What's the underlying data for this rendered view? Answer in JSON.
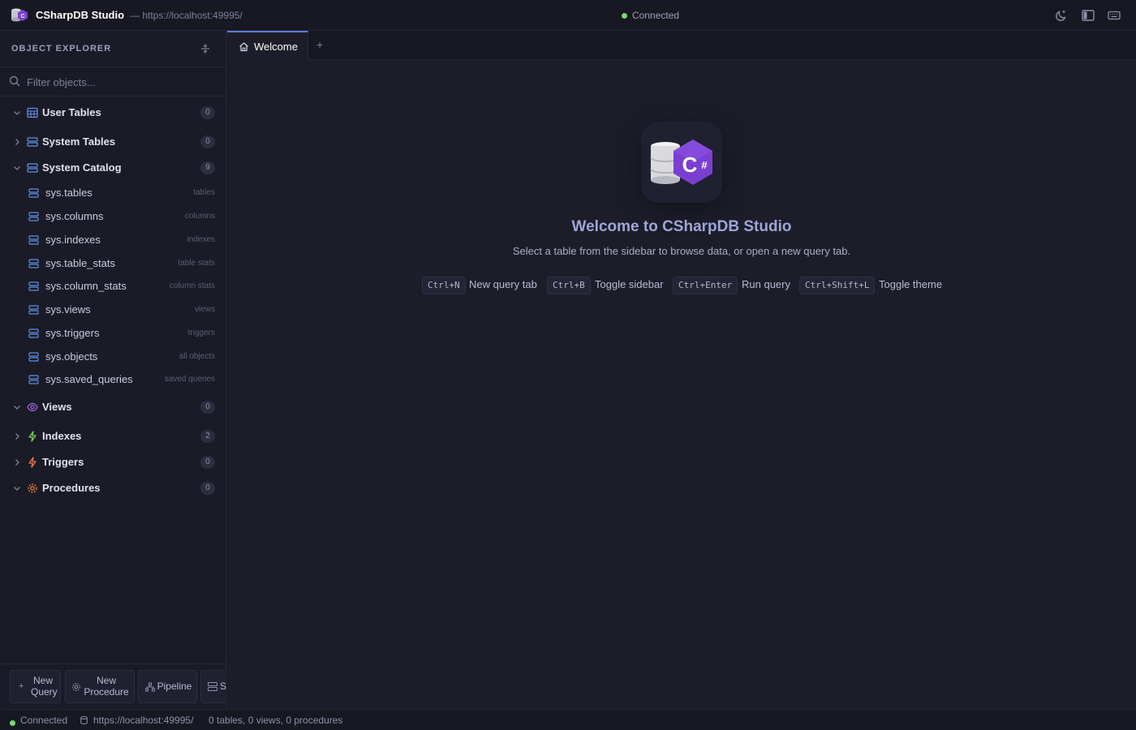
{
  "app": {
    "title": "CSharpDB Studio",
    "url": "— https://localhost:49995/",
    "status": "Connected"
  },
  "icons": {
    "theme": "moon-icon",
    "sidebar": "panel-left-icon",
    "shortcuts": "keyboard-icon"
  },
  "sidebar": {
    "header": "OBJECT EXPLORER",
    "filter_placeholder": "Filter objects...",
    "groups": [
      {
        "label": "User Tables",
        "count": "0",
        "expanded": true
      },
      {
        "label": "System Tables",
        "count": "0",
        "expanded": false
      },
      {
        "label": "System Catalog",
        "count": "9",
        "expanded": true
      },
      {
        "label": "Views",
        "count": "0",
        "expanded": true
      },
      {
        "label": "Indexes",
        "count": "2",
        "expanded": false
      },
      {
        "label": "Triggers",
        "count": "0",
        "expanded": false
      },
      {
        "label": "Procedures",
        "count": "0",
        "expanded": true
      }
    ],
    "catalog_items": [
      {
        "label": "sys.tables",
        "hint": "tables"
      },
      {
        "label": "sys.columns",
        "hint": "columns"
      },
      {
        "label": "sys.indexes",
        "hint": "indexes"
      },
      {
        "label": "sys.table_stats",
        "hint": "table stats"
      },
      {
        "label": "sys.column_stats",
        "hint": "column stats"
      },
      {
        "label": "sys.views",
        "hint": "views"
      },
      {
        "label": "sys.triggers",
        "hint": "triggers"
      },
      {
        "label": "sys.objects",
        "hint": "all objects"
      },
      {
        "label": "sys.saved_queries",
        "hint": "saved queries"
      }
    ],
    "footer": {
      "new_query": [
        "New",
        "Query"
      ],
      "new_procedure": [
        "New",
        "Procedure"
      ],
      "pipeline": "Pipeline",
      "truncated": "St"
    }
  },
  "tabs": [
    {
      "label": "Welcome",
      "active": true
    }
  ],
  "tab_add": "+",
  "welcome": {
    "title": "Welcome to CSharpDB Studio",
    "subtitle": "Select a table from the sidebar to browse data, or open a new query tab.",
    "shortcuts": [
      {
        "keys": "Ctrl+N",
        "label": "New query tab"
      },
      {
        "keys": "Ctrl+B",
        "label": "Toggle sidebar"
      },
      {
        "keys": "Ctrl+Enter",
        "label": "Run query"
      },
      {
        "keys": "Ctrl+Shift+L",
        "label": "Toggle theme"
      }
    ]
  },
  "statusbar": {
    "status": "Connected",
    "url": "https://localhost:49995/",
    "summary": "0 tables, 0 views, 0 procedures"
  },
  "colors": {
    "accent": "#5d7bd8",
    "connected": "#7bd66b",
    "brand_purple": "#7a3fd0"
  }
}
